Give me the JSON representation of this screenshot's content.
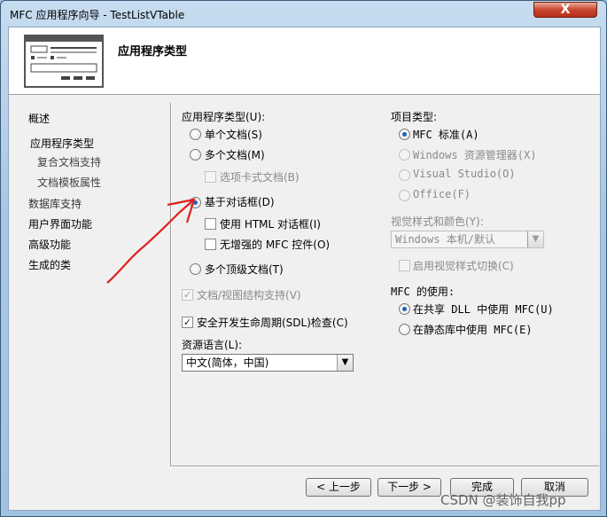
{
  "window": {
    "title": "MFC 应用程序向导 - TestListVTable",
    "close_glyph": "X"
  },
  "header": {
    "title": "应用程序类型"
  },
  "nav": {
    "items": [
      {
        "label": "概述"
      },
      {
        "label": "应用程序类型"
      },
      {
        "label": "复合文档支持"
      },
      {
        "label": "文档模板属性"
      },
      {
        "label": "数据库支持"
      },
      {
        "label": "用户界面功能"
      },
      {
        "label": "高级功能"
      },
      {
        "label": "生成的类"
      }
    ]
  },
  "app_type": {
    "label": "应用程序类型(U):",
    "single_doc": "单个文档(S)",
    "multi_doc": "多个文档(M)",
    "tabbed_doc": "选项卡式文档(B)",
    "dialog_based": "基于对话框(D)",
    "use_html_dialog": "使用 HTML 对话框(I)",
    "no_enhanced_mfc": "无增强的 MFC 控件(O)",
    "multi_top_level": "多个顶级文档(T)",
    "selected": "基于对话框(D)"
  },
  "doc_view_support": "文档/视图结构支持(V)",
  "sdl_checks": "安全开发生命周期(SDL)检查(C)",
  "resource_language": {
    "label": "资源语言(L):",
    "value": "中文(简体，中国)"
  },
  "project_type": {
    "label": "项目类型:",
    "mfc_standard": "MFC 标准(A)",
    "windows_explorer": "Windows 资源管理器(X)",
    "visual_studio": "Visual Studio(O)",
    "office": "Office(F)",
    "selected": "MFC 标准(A)"
  },
  "visual_style": {
    "label": "视觉样式和颜色(Y):",
    "value": "Windows 本机/默认",
    "enable_switch": "启用视觉样式切换(C)"
  },
  "mfc_usage": {
    "label": "MFC 的使用:",
    "shared_dll": "在共享 DLL 中使用 MFC(U)",
    "static_lib": "在静态库中使用 MFC(E)",
    "selected": "在共享 DLL 中使用 MFC(U)"
  },
  "buttons": {
    "back": "< 上一步",
    "next": "下一步 >",
    "finish": "完成",
    "cancel": "取消"
  },
  "watermark": "CSDN @装饰自我pp",
  "colors": {
    "annotation_arrow": "#e0201e",
    "selection_accent": "#1f5fbf"
  }
}
